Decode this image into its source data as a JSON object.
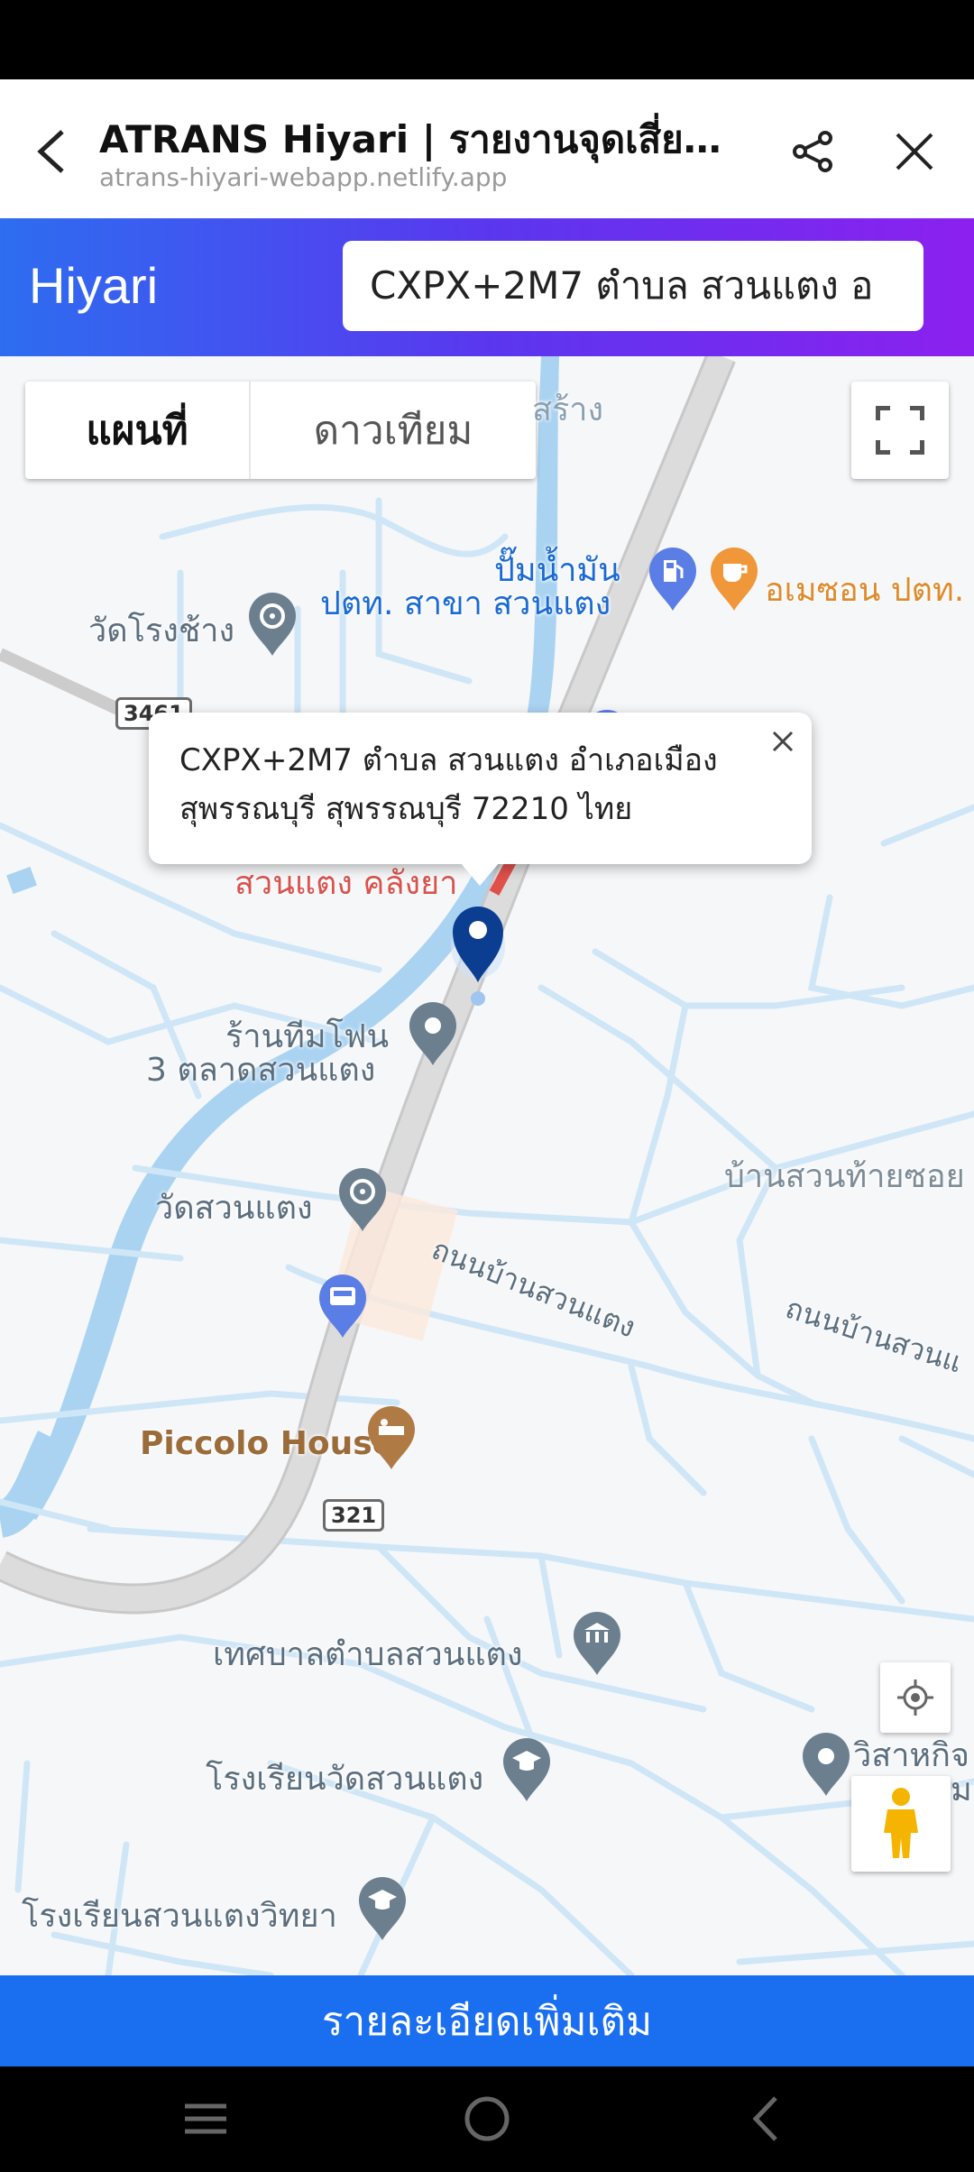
{
  "browser": {
    "title": "ATRANS Hiyari | รายงานจุดเสี่ยงใ...",
    "url": "atrans-hiyari-webapp.netlify.app"
  },
  "app": {
    "brand": "Hiyari",
    "search_value": "CXPX+2M7 ตำบล สวนแตง อ"
  },
  "map": {
    "type_map": "แผนที่",
    "type_satellite": "ดาวเทียม",
    "infowindow": {
      "line1": "CXPX+2M7 ตำบล สวนแตง อำเภอเมือง",
      "line2": "สุพรรณบุรี สุพรรณบุรี 72210 ไทย"
    },
    "labels": {
      "top_cut": "สร้าง",
      "gas_station_1": "ปั๊มน้ำมัน",
      "gas_station_2": "ปตท. สาขา สวนแตง",
      "cafe": "อเมซอน ปตท.",
      "temple_rongchang": "วัดโรงช้าง",
      "cut_red": "สวนแตง คลังยา",
      "phone_shop": "ร้านทีมโฟน",
      "market": "3 ตลาดสวนแตง",
      "village": "บ้านสวนท้ายซอย",
      "temple_suantaeng": "วัดสวนแตง",
      "road_1": "ถนนบ้านสวนแตง",
      "road_2": "ถนนบ้านสวนแ",
      "piccolo": "Piccolo House",
      "municipality": "เทศบาลตำบลสวนแตง",
      "school_temple": "โรงเรียนวัดสวนแตง",
      "school_wittaya": "โรงเรียนสวนแตงวิทยา",
      "right_edge_1": "วิสาหกิจ",
      "right_edge_2": "ม"
    },
    "shields": {
      "route_a": "3461",
      "route_b": "321"
    },
    "icons": {
      "poi_pin": "map-pin-icon",
      "temple": "temple-icon",
      "gas": "gas-station-icon",
      "cafe": "cafe-icon",
      "bus": "bus-stop-icon",
      "hotel": "hotel-icon",
      "government": "government-icon",
      "school": "school-icon"
    },
    "colors": {
      "water": "#aad3f2",
      "road_main": "#d9d9d9",
      "road_minor": "#cfe6f7",
      "marker": "#0b3d91"
    }
  },
  "detail_button": "รายละเอียดเพิ่มเติม"
}
